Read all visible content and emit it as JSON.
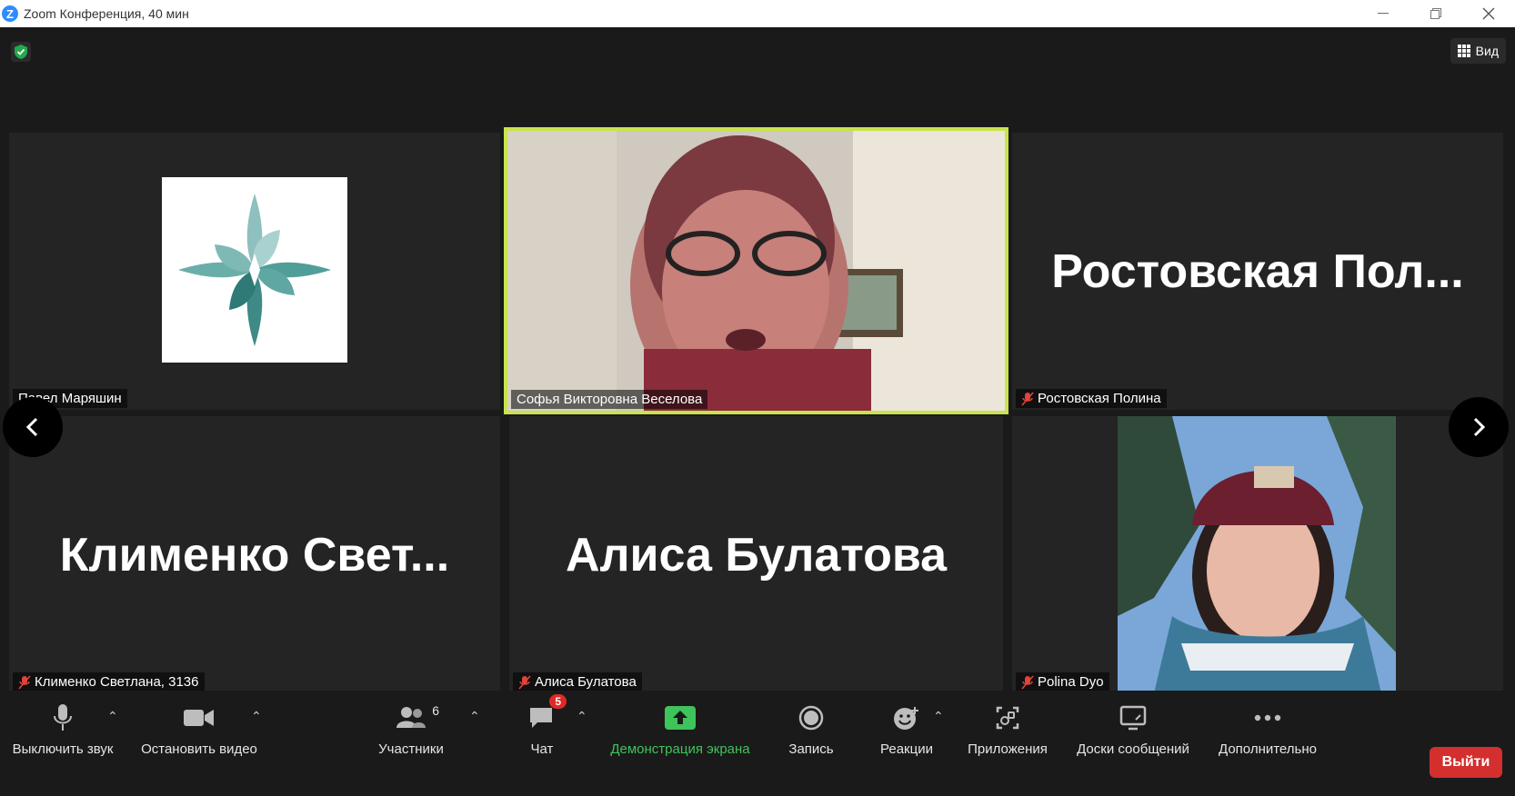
{
  "window": {
    "title": "Zoom Конференция, 40 мин",
    "controls": [
      "minimize",
      "restore",
      "close"
    ]
  },
  "header": {
    "view_label": "Вид"
  },
  "participants": [
    {
      "name_label": "Павел Маряшин",
      "muted": false,
      "tile": "logo"
    },
    {
      "name_label": "Софья Викторовна Веселова",
      "muted": false,
      "tile": "video",
      "active_speaker": true
    },
    {
      "name_label": "Ростовская Полина",
      "big_name": "Ростовская  Пол...",
      "muted": true,
      "tile": "name"
    },
    {
      "name_label": "Клименко Светлана, 3136",
      "big_name": "Клименко  Свет...",
      "muted": true,
      "tile": "name"
    },
    {
      "name_label": "Алиса Булатова",
      "big_name": "Алиса Булатова",
      "muted": true,
      "tile": "name"
    },
    {
      "name_label": "Polina Dyo",
      "muted": true,
      "tile": "video"
    }
  ],
  "toolbar": {
    "mute": "Выключить звук",
    "video": "Остановить видео",
    "participants": "Участники",
    "participants_count": "6",
    "chat": "Чат",
    "chat_badge": "5",
    "share": "Демонстрация экрана",
    "record": "Запись",
    "reactions": "Реакции",
    "apps": "Приложения",
    "whiteboards": "Доски сообщений",
    "more": "Дополнительно",
    "leave": "Выйти"
  },
  "colors": {
    "accent_green": "#3fc35b",
    "active_speaker": "#c8e34d",
    "leave_red": "#d32f2f",
    "muted_red": "#e0443a"
  }
}
